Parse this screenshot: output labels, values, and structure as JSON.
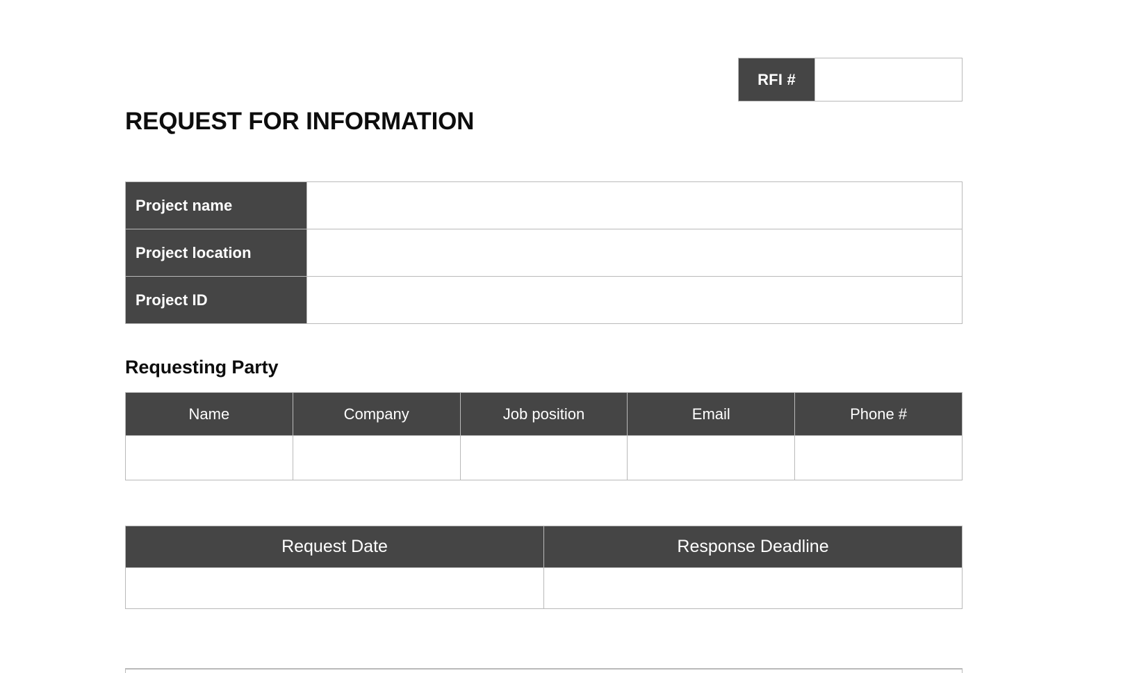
{
  "document": {
    "title": "REQUEST FOR INFORMATION"
  },
  "rfi": {
    "label": "RFI #",
    "value": ""
  },
  "project": {
    "rows": [
      {
        "label": "Project name",
        "value": ""
      },
      {
        "label": "Project location",
        "value": ""
      },
      {
        "label": "Project ID",
        "value": ""
      }
    ]
  },
  "requesting_party": {
    "heading": "Requesting Party",
    "columns": [
      "Name",
      "Company",
      "Job position",
      "Email",
      "Phone #"
    ],
    "rows": [
      {
        "name": "",
        "company": "",
        "job_position": "",
        "email": "",
        "phone": ""
      }
    ]
  },
  "dates": {
    "columns": [
      "Request Date",
      "Response Deadline"
    ],
    "rows": [
      {
        "request_date": "",
        "response_deadline": ""
      }
    ]
  },
  "colors": {
    "header_fill": "#454545",
    "border": "#b9b9b9",
    "text_dark": "#0d0d0d",
    "text_on_dark": "#ffffff",
    "page_background": "#ffffff"
  }
}
